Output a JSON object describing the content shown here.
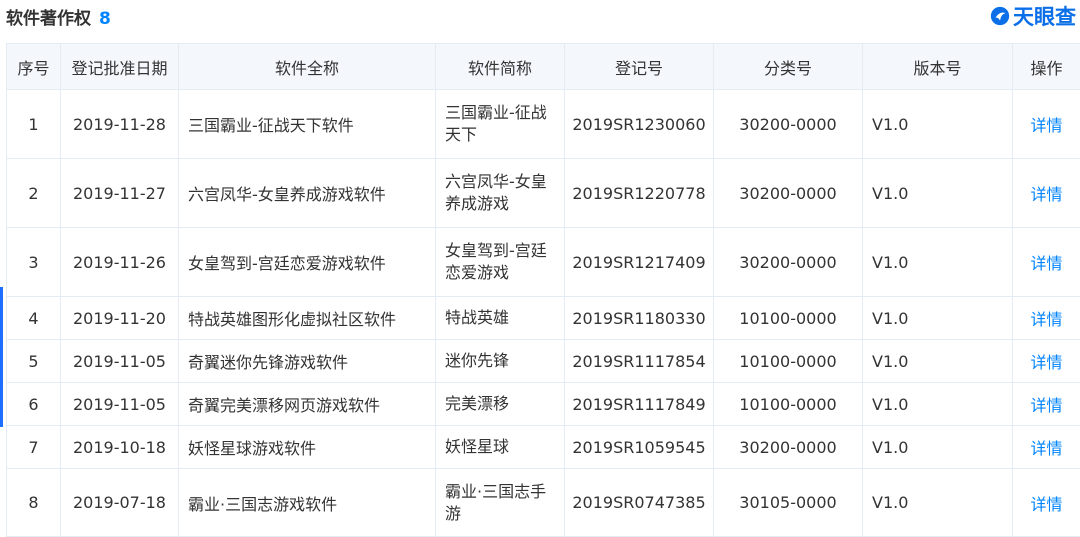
{
  "section": {
    "title": "软件著作权",
    "count": "8"
  },
  "logo": {
    "text": "天眼查",
    "brand_color": "#0b6fe8"
  },
  "colors": {
    "accent": "#0084ff",
    "header_bg": "#f4f8fd",
    "border": "#e5ebf3"
  },
  "table": {
    "headers": [
      "序号",
      "登记批准日期",
      "软件全称",
      "软件简称",
      "登记号",
      "分类号",
      "版本号",
      "操作"
    ],
    "rows": [
      {
        "index": "1",
        "date": "2019-11-28",
        "full_name": "三国霸业-征战天下软件",
        "short_name": "三国霸业-征战天下",
        "reg_no": "2019SR1230060",
        "class_no": "30200-0000",
        "version": "V1.0",
        "action": "详情"
      },
      {
        "index": "2",
        "date": "2019-11-27",
        "full_name": "六宫凤华-女皇养成游戏软件",
        "short_name": "六宫凤华-女皇养成游戏",
        "reg_no": "2019SR1220778",
        "class_no": "30200-0000",
        "version": "V1.0",
        "action": "详情"
      },
      {
        "index": "3",
        "date": "2019-11-26",
        "full_name": "女皇驾到-宫廷恋爱游戏软件",
        "short_name": "女皇驾到-宫廷恋爱游戏",
        "reg_no": "2019SR1217409",
        "class_no": "30200-0000",
        "version": "V1.0",
        "action": "详情"
      },
      {
        "index": "4",
        "date": "2019-11-20",
        "full_name": "特战英雄图形化虚拟社区软件",
        "short_name": "特战英雄",
        "reg_no": "2019SR1180330",
        "class_no": "10100-0000",
        "version": "V1.0",
        "action": "详情"
      },
      {
        "index": "5",
        "date": "2019-11-05",
        "full_name": "奇翼迷你先锋游戏软件",
        "short_name": "迷你先锋",
        "reg_no": "2019SR1117854",
        "class_no": "10100-0000",
        "version": "V1.0",
        "action": "详情"
      },
      {
        "index": "6",
        "date": "2019-11-05",
        "full_name": "奇翼完美漂移网页游戏软件",
        "short_name": "完美漂移",
        "reg_no": "2019SR1117849",
        "class_no": "10100-0000",
        "version": "V1.0",
        "action": "详情"
      },
      {
        "index": "7",
        "date": "2019-10-18",
        "full_name": "妖怪星球游戏软件",
        "short_name": "妖怪星球",
        "reg_no": "2019SR1059545",
        "class_no": "30200-0000",
        "version": "V1.0",
        "action": "详情"
      },
      {
        "index": "8",
        "date": "2019-07-18",
        "full_name": "霸业·三国志游戏软件",
        "short_name": "霸业·三国志手游",
        "reg_no": "2019SR0747385",
        "class_no": "30105-0000",
        "version": "V1.0",
        "action": "详情"
      }
    ]
  }
}
